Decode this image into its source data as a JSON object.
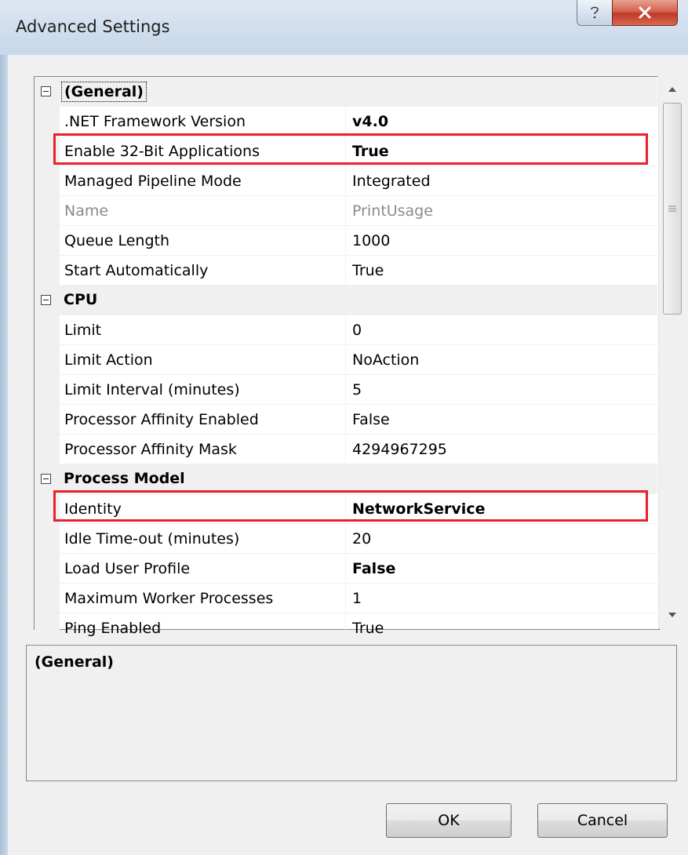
{
  "window": {
    "title": "Advanced Settings",
    "help_icon": "question-mark-icon",
    "close_icon": "close-x-icon"
  },
  "grid": {
    "categories": [
      {
        "label": "(General)",
        "properties": [
          {
            "name": ".NET Framework Version",
            "value": "v4.0"
          },
          {
            "name": "Enable 32-Bit Applications",
            "value": "True"
          },
          {
            "name": "Managed Pipeline Mode",
            "value": "Integrated"
          },
          {
            "name": "Name",
            "value": "PrintUsage"
          },
          {
            "name": "Queue Length",
            "value": "1000"
          },
          {
            "name": "Start Automatically",
            "value": "True"
          }
        ]
      },
      {
        "label": "CPU",
        "properties": [
          {
            "name": "Limit",
            "value": "0"
          },
          {
            "name": "Limit Action",
            "value": "NoAction"
          },
          {
            "name": "Limit Interval (minutes)",
            "value": "5"
          },
          {
            "name": "Processor Affinity Enabled",
            "value": "False"
          },
          {
            "name": "Processor Affinity Mask",
            "value": "4294967295"
          }
        ]
      },
      {
        "label": "Process Model",
        "properties": [
          {
            "name": "Identity",
            "value": "NetworkService"
          },
          {
            "name": "Idle Time-out (minutes)",
            "value": "20"
          },
          {
            "name": "Load User Profile",
            "value": "False"
          },
          {
            "name": "Maximum Worker Processes",
            "value": "1"
          },
          {
            "name": "Ping Enabled",
            "value": "True"
          }
        ]
      }
    ],
    "highlight_color": "#e8212b"
  },
  "description": {
    "title": "(General)"
  },
  "buttons": {
    "ok_label": "OK",
    "cancel_label": "Cancel"
  }
}
